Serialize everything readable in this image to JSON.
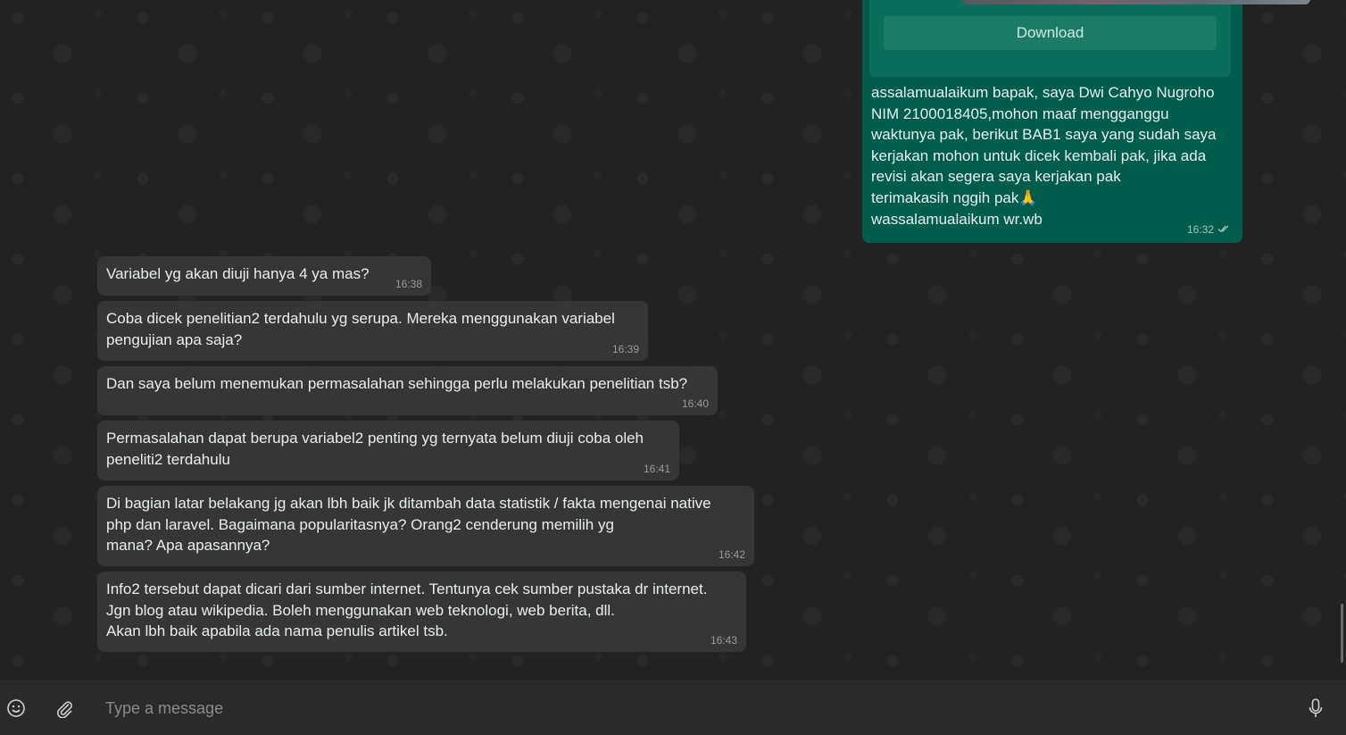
{
  "outgoing": {
    "download_label": "Download",
    "text": "assalamualaikum bapak, saya Dwi Cahyo Nugroho\nNIM 2100018405,mohon maaf mengganggu\nwaktunya pak, berikut BAB1 saya yang sudah saya\nkerjakan mohon untuk dicek kembali pak, jika ada\nrevisi akan segera saya kerjakan pak\nterimakasih nggih pak🙏\nwassalamualaikum wr.wb",
    "time": "16:32",
    "status_icon": "double-check-icon"
  },
  "incoming": [
    {
      "text": "Variabel yg akan diuji hanya 4 ya mas?",
      "time": "16:38"
    },
    {
      "text": "Coba dicek penelitian2 terdahulu yg serupa. Mereka menggunakan variabel\npengujian apa saja?",
      "time": "16:39"
    },
    {
      "text": "Dan saya belum menemukan permasalahan sehingga perlu melakukan penelitian tsb?",
      "time": "16:40"
    },
    {
      "text": "Permasalahan dapat berupa variabel2 penting yg ternyata belum diuji coba oleh\npeneliti2 terdahulu",
      "time": "16:41"
    },
    {
      "text": "Di bagian latar belakang jg akan lbh baik jk ditambah data statistik / fakta mengenai native\nphp dan laravel. Bagaimana popularitasnya? Orang2 cenderung memilih yg\nmana? Apa apasannya?",
      "time": "16:42"
    },
    {
      "text": "Info2 tersebut dapat dicari dari sumber internet. Tentunya cek sumber pustaka dr internet.\nJgn blog atau wikipedia. Boleh menggunakan web teknologi, web berita, dll.\nAkan lbh baik apabila ada nama penulis artikel tsb.",
      "time": "16:43"
    }
  ],
  "composer": {
    "placeholder": "Type a message",
    "emoji_icon": "emoji-icon",
    "attach_icon": "paperclip-icon",
    "mic_icon": "microphone-icon"
  },
  "colors": {
    "outgoing_bubble": "#005c4b",
    "incoming_bubble": "#363636",
    "background": "#222222"
  }
}
